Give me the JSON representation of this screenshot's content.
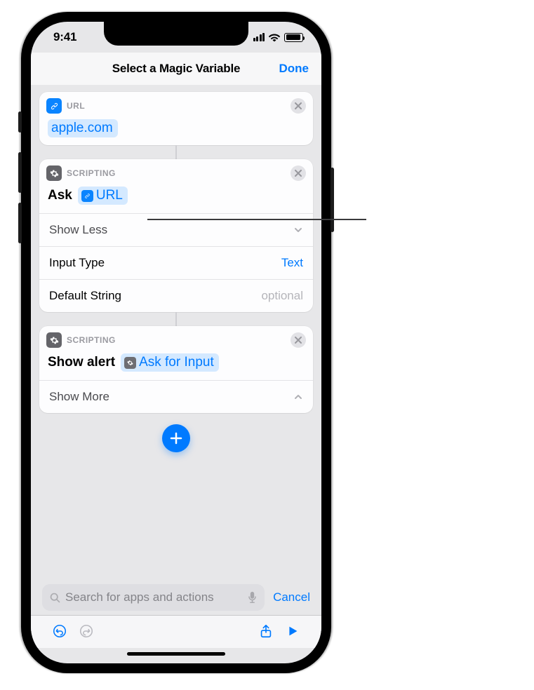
{
  "status": {
    "time": "9:41"
  },
  "nav": {
    "title": "Select a Magic Variable",
    "done": "Done"
  },
  "card_url": {
    "category": "URL",
    "value": "apple.com"
  },
  "card_ask": {
    "category": "SCRIPTING",
    "action": "Ask",
    "variable": "URL",
    "show_less": "Show Less",
    "rows": {
      "input_type": {
        "label": "Input Type",
        "value": "Text"
      },
      "default_string": {
        "label": "Default String",
        "value": "optional"
      }
    }
  },
  "card_alert": {
    "category": "SCRIPTING",
    "action": "Show alert",
    "variable": "Ask for Input",
    "show_more": "Show More"
  },
  "search": {
    "placeholder": "Search for apps and actions",
    "cancel": "Cancel"
  }
}
